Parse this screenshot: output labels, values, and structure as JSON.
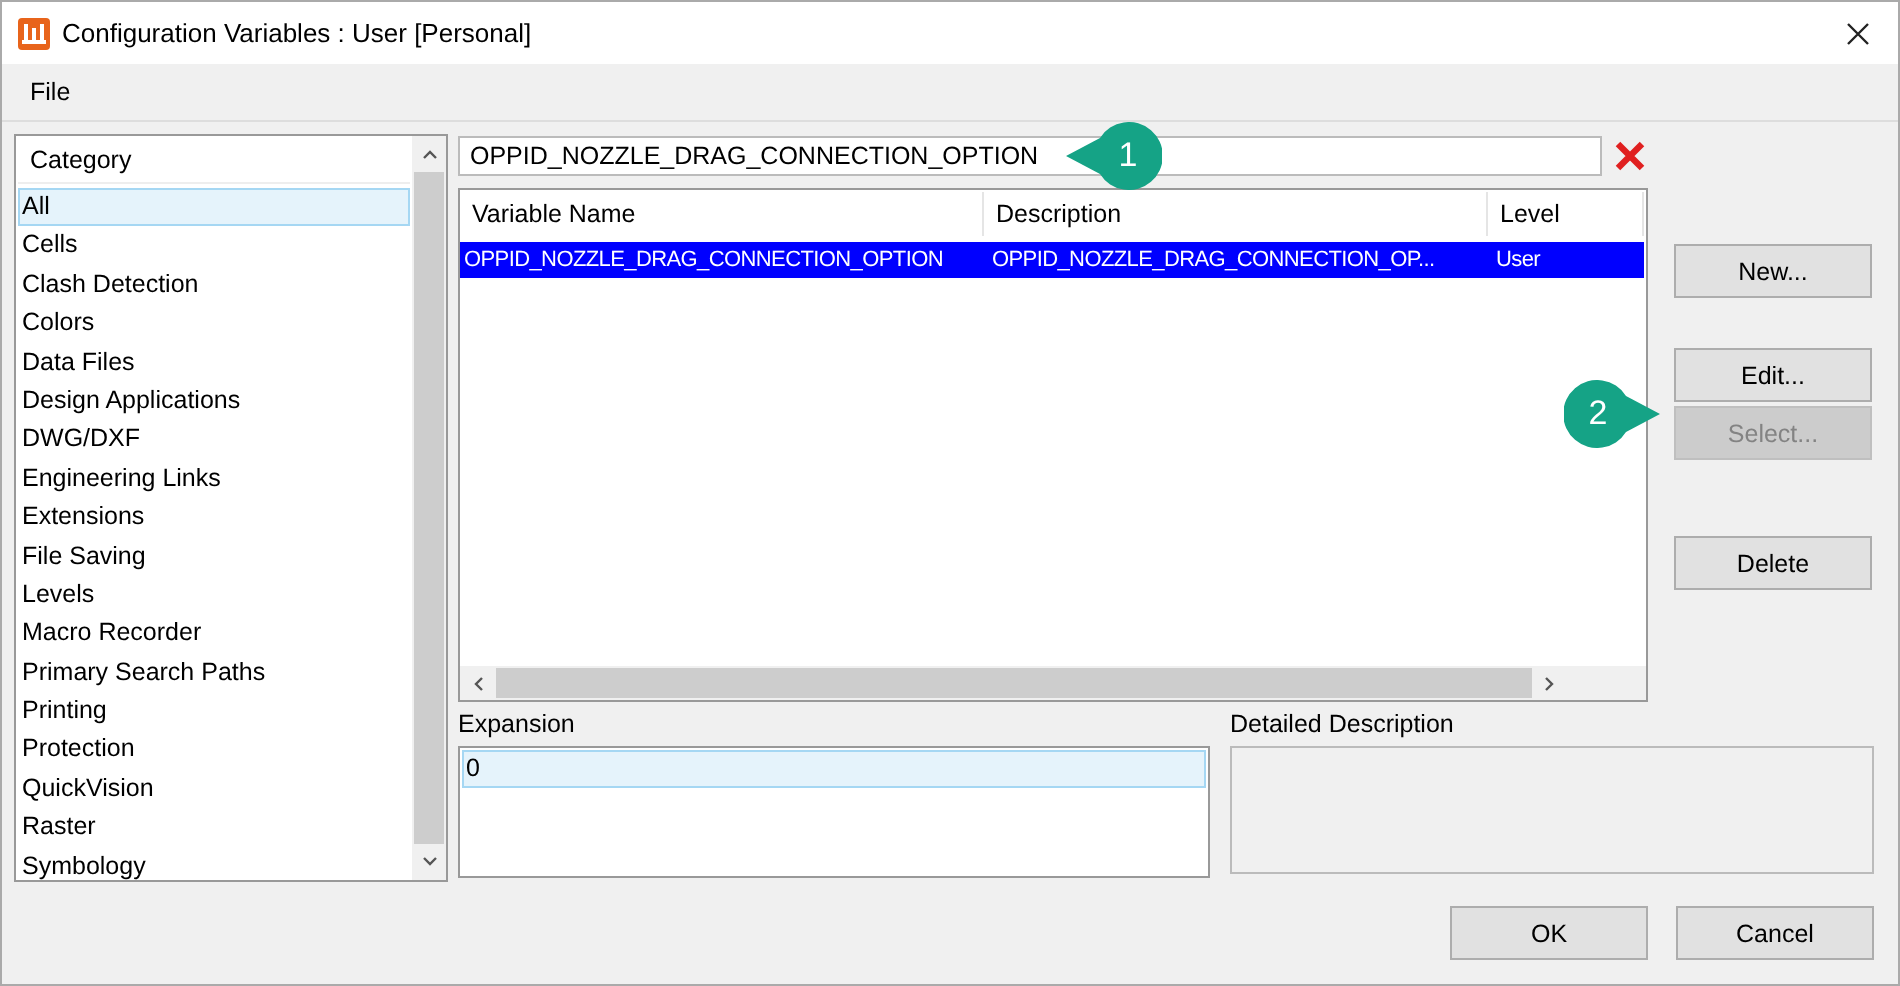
{
  "window": {
    "title": "Configuration Variables : User [Personal]"
  },
  "menu": [
    {
      "label": "File"
    }
  ],
  "category_list": {
    "header": "Category",
    "items": [
      {
        "label": "All",
        "selected": true
      },
      {
        "label": "Cells",
        "selected": false
      },
      {
        "label": "Clash Detection",
        "selected": false
      },
      {
        "label": "Colors",
        "selected": false
      },
      {
        "label": "Data Files",
        "selected": false
      },
      {
        "label": "Design Applications",
        "selected": false
      },
      {
        "label": "DWG/DXF",
        "selected": false
      },
      {
        "label": "Engineering Links",
        "selected": false
      },
      {
        "label": "Extensions",
        "selected": false
      },
      {
        "label": "File Saving",
        "selected": false
      },
      {
        "label": "Levels",
        "selected": false
      },
      {
        "label": "Macro Recorder",
        "selected": false
      },
      {
        "label": "Primary Search Paths",
        "selected": false
      },
      {
        "label": "Printing",
        "selected": false
      },
      {
        "label": "Protection",
        "selected": false
      },
      {
        "label": "QuickVision",
        "selected": false
      },
      {
        "label": "Raster",
        "selected": false
      },
      {
        "label": "Symbology",
        "selected": false
      }
    ]
  },
  "search": {
    "value": "OPPID_NOZZLE_DRAG_CONNECTION_OPTION"
  },
  "table": {
    "columns": [
      "Variable Name",
      "Description",
      "Level"
    ],
    "rows": [
      {
        "cells": [
          "OPPID_NOZZLE_DRAG_CONNECTION_OPTION",
          "OPPID_NOZZLE_DRAG_CONNECTION_OP...",
          "User"
        ],
        "selected": true
      }
    ]
  },
  "side_buttons": [
    {
      "label": "New...",
      "disabled": false
    },
    {
      "label": "Edit...",
      "disabled": false
    },
    {
      "label": "Select...",
      "disabled": true
    },
    {
      "label": "Delete",
      "disabled": false
    }
  ],
  "expansion": {
    "label": "Expansion",
    "items": [
      {
        "label": "0",
        "selected": true
      }
    ]
  },
  "detailed_description": {
    "label": "Detailed Description"
  },
  "callouts": [
    {
      "number": "1"
    },
    {
      "number": "2"
    }
  ],
  "dialog_buttons": [
    {
      "label": "OK"
    },
    {
      "label": "Cancel"
    }
  ]
}
